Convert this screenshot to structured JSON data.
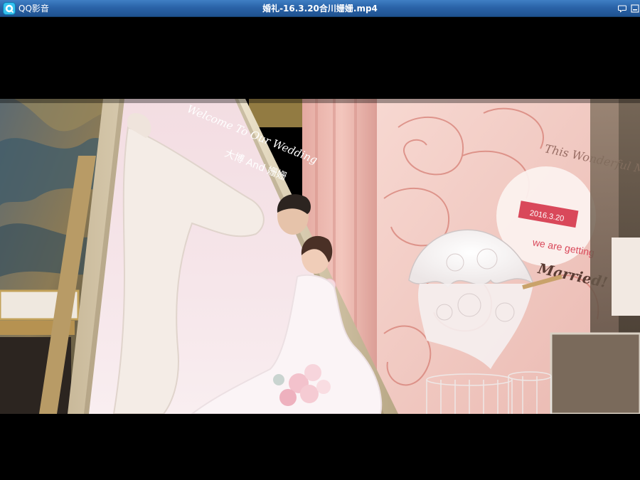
{
  "window": {
    "app_name": "QQ影音",
    "file_title": "婚礼-16.3.20合川姗姗.mp4"
  },
  "titlebar": {
    "buttons": [
      {
        "icon": "chat-bubble-icon"
      },
      {
        "icon": "minimize-icon"
      }
    ]
  },
  "video": {
    "frame_text": {
      "welcome": "Welcome To Our Wedding",
      "couple": "大博 And 姗姗",
      "wonderful": "This Wonderful Moment",
      "date": "2016.3.20",
      "getting": "we are getting",
      "married": "Married!"
    }
  },
  "colors": {
    "titlebar_top": "#3f7fc4",
    "titlebar_bottom": "#1f528f",
    "letterbox": "#000000",
    "backdrop_pink": "#f2c9c2",
    "ribbon_red": "#d9485a"
  }
}
